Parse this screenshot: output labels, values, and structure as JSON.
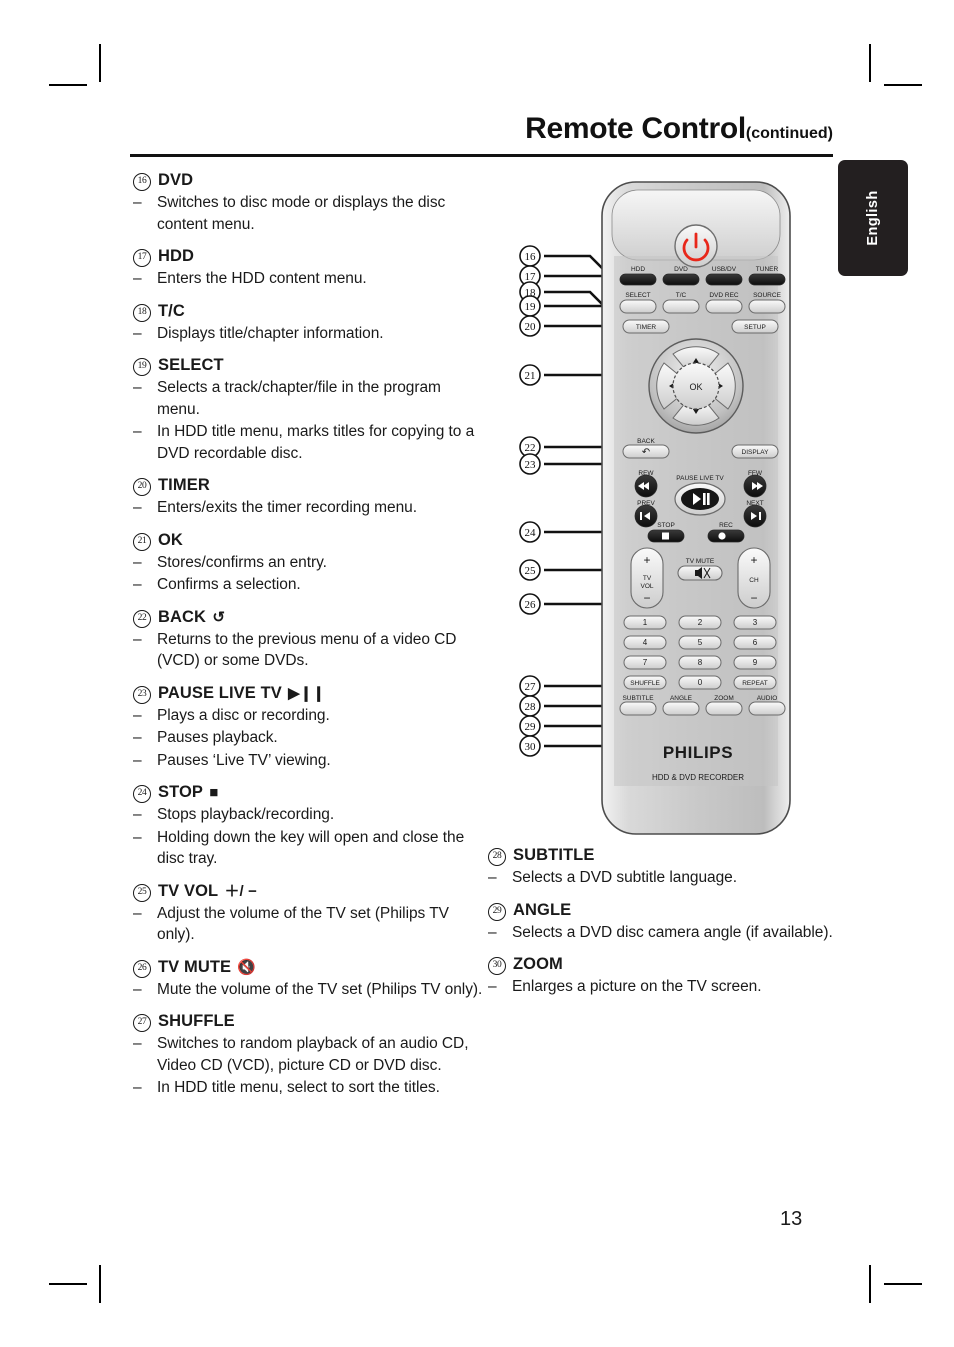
{
  "header": {
    "title": "Remote Control",
    "subtitle": "(continued)"
  },
  "side_tab": {
    "label": "English"
  },
  "page_number": "13",
  "left_column": [
    {
      "num": "16",
      "title": "DVD",
      "symbol": "",
      "bullets": [
        "Switches to disc mode or displays the disc content menu."
      ]
    },
    {
      "num": "17",
      "title": "HDD",
      "symbol": "",
      "bullets": [
        "Enters the HDD content menu."
      ]
    },
    {
      "num": "18",
      "title": "T/C",
      "symbol": "",
      "bullets": [
        "Displays title/chapter information."
      ]
    },
    {
      "num": "19",
      "title": "SELECT",
      "symbol": "",
      "bullets": [
        "Selects a track/chapter/file in the program menu.",
        "In HDD title menu, marks titles for copying to a DVD recordable disc."
      ]
    },
    {
      "num": "20",
      "title": "TIMER",
      "symbol": "",
      "bullets": [
        "Enters/exits the timer recording menu."
      ]
    },
    {
      "num": "21",
      "title": "OK",
      "symbol": "",
      "bullets": [
        "Stores/confirms an entry.",
        "Confirms a selection."
      ]
    },
    {
      "num": "22",
      "title": "BACK",
      "symbol": "↺",
      "bullets": [
        "Returns to the previous menu of a video CD (VCD) or some DVDs."
      ]
    },
    {
      "num": "23",
      "title": "PAUSE LIVE TV",
      "symbol": "▶❙❙",
      "bullets": [
        "Plays a disc or recording.",
        "Pauses playback.",
        "Pauses ‘Live TV’ viewing."
      ]
    },
    {
      "num": "24",
      "title": "STOP",
      "symbol": "■",
      "bullets": [
        "Stops playback/recording.",
        "Holding down the key will open and close the disc tray."
      ]
    },
    {
      "num": "25",
      "title": "TV VOL",
      "symbol": "＋/ −",
      "bullets": [
        "Adjust the volume of the TV set (Philips TV only)."
      ]
    },
    {
      "num": "26",
      "title": "TV MUTE",
      "symbol": "🔇",
      "bullets": [
        "Mute the volume of the TV set (Philips TV only)."
      ]
    },
    {
      "num": "27",
      "title": "SHUFFLE",
      "symbol": "",
      "bullets": [
        "Switches to random playback of an audio CD, Video CD (VCD), picture CD or DVD disc.",
        "In HDD title menu, select to sort the titles."
      ]
    }
  ],
  "right_column": [
    {
      "num": "28",
      "title": "SUBTITLE",
      "symbol": "",
      "bullets": [
        "Selects a DVD subtitle language."
      ]
    },
    {
      "num": "29",
      "title": "ANGLE",
      "symbol": "",
      "bullets": [
        "Selects a DVD disc camera angle (if available)."
      ]
    },
    {
      "num": "30",
      "title": "ZOOM",
      "symbol": "",
      "bullets": [
        "Enlarges a picture on the TV screen."
      ]
    }
  ],
  "remote": {
    "brand": "PHILIPS",
    "model_text": "HDD & DVD RECORDER",
    "power_color": "#e8271a",
    "body_color": "#c8c8c8",
    "callout_numbers": [
      "16",
      "17",
      "18",
      "19",
      "20",
      "21",
      "22",
      "23",
      "24",
      "25",
      "26",
      "27",
      "28",
      "29",
      "30"
    ],
    "buttons": {
      "row_source_1": [
        "HDD",
        "DVD",
        "USB/DV",
        "TUNER"
      ],
      "row_source_2": [
        "SELECT",
        "T/C",
        "DVD REC",
        "SOURCE"
      ],
      "timer": "TIMER",
      "setup": "SETUP",
      "ok": "OK",
      "back": "BACK",
      "display": "DISPLAY",
      "rew": "REW",
      "ffw": "FFW",
      "prev": "PREV",
      "next": "NEXT",
      "pause_live_tv": "PAUSE LIVE TV",
      "stop": "STOP",
      "rec": "REC",
      "tv_vol": "TV VOL",
      "tv_mute": "TV MUTE",
      "ch": "CH",
      "plus": "＋",
      "minus": "−",
      "keypad": [
        "1",
        "2",
        "3",
        "4",
        "5",
        "6",
        "7",
        "8",
        "9"
      ],
      "shuffle": "SHUFFLE",
      "zero": "0",
      "repeat": "REPEAT",
      "row_bottom": [
        "SUBTITLE",
        "ANGLE",
        "ZOOM",
        "AUDIO"
      ]
    }
  }
}
